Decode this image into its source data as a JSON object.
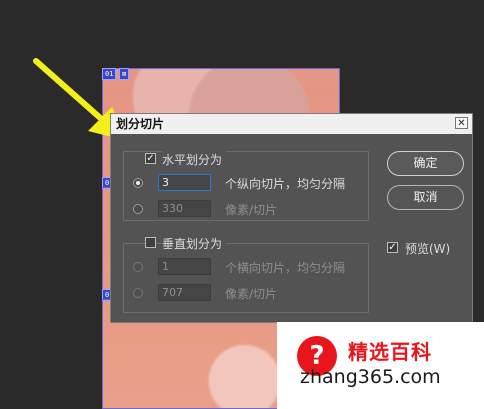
{
  "canvas": {
    "slice_tags": [
      "01",
      "⊠",
      "0",
      "0"
    ]
  },
  "dialog": {
    "title": "划分切片",
    "close_label": "✕",
    "horizontal": {
      "checkbox_label": "水平划分为",
      "checked": true,
      "option1": {
        "value": "3",
        "suffix": "个纵向切片，均匀分隔",
        "selected": true
      },
      "option2": {
        "value": "330",
        "suffix": "像素/切片",
        "selected": false
      }
    },
    "vertical": {
      "checkbox_label": "垂直划分为",
      "checked": false,
      "option1": {
        "value": "1",
        "suffix": "个横向切片，均匀分隔"
      },
      "option2": {
        "value": "707",
        "suffix": "像素/切片"
      }
    },
    "ok_label": "确定",
    "cancel_label": "取消",
    "preview_label": "预览(W)",
    "preview_checked": true,
    "checkmark": "✓"
  },
  "watermark": {
    "icon_glyph": "?",
    "title": "精选百科",
    "url": "zhang365.com"
  },
  "colors": {
    "accent_arrow": "#f2ef1b",
    "watermark_red": "#e8161c"
  }
}
